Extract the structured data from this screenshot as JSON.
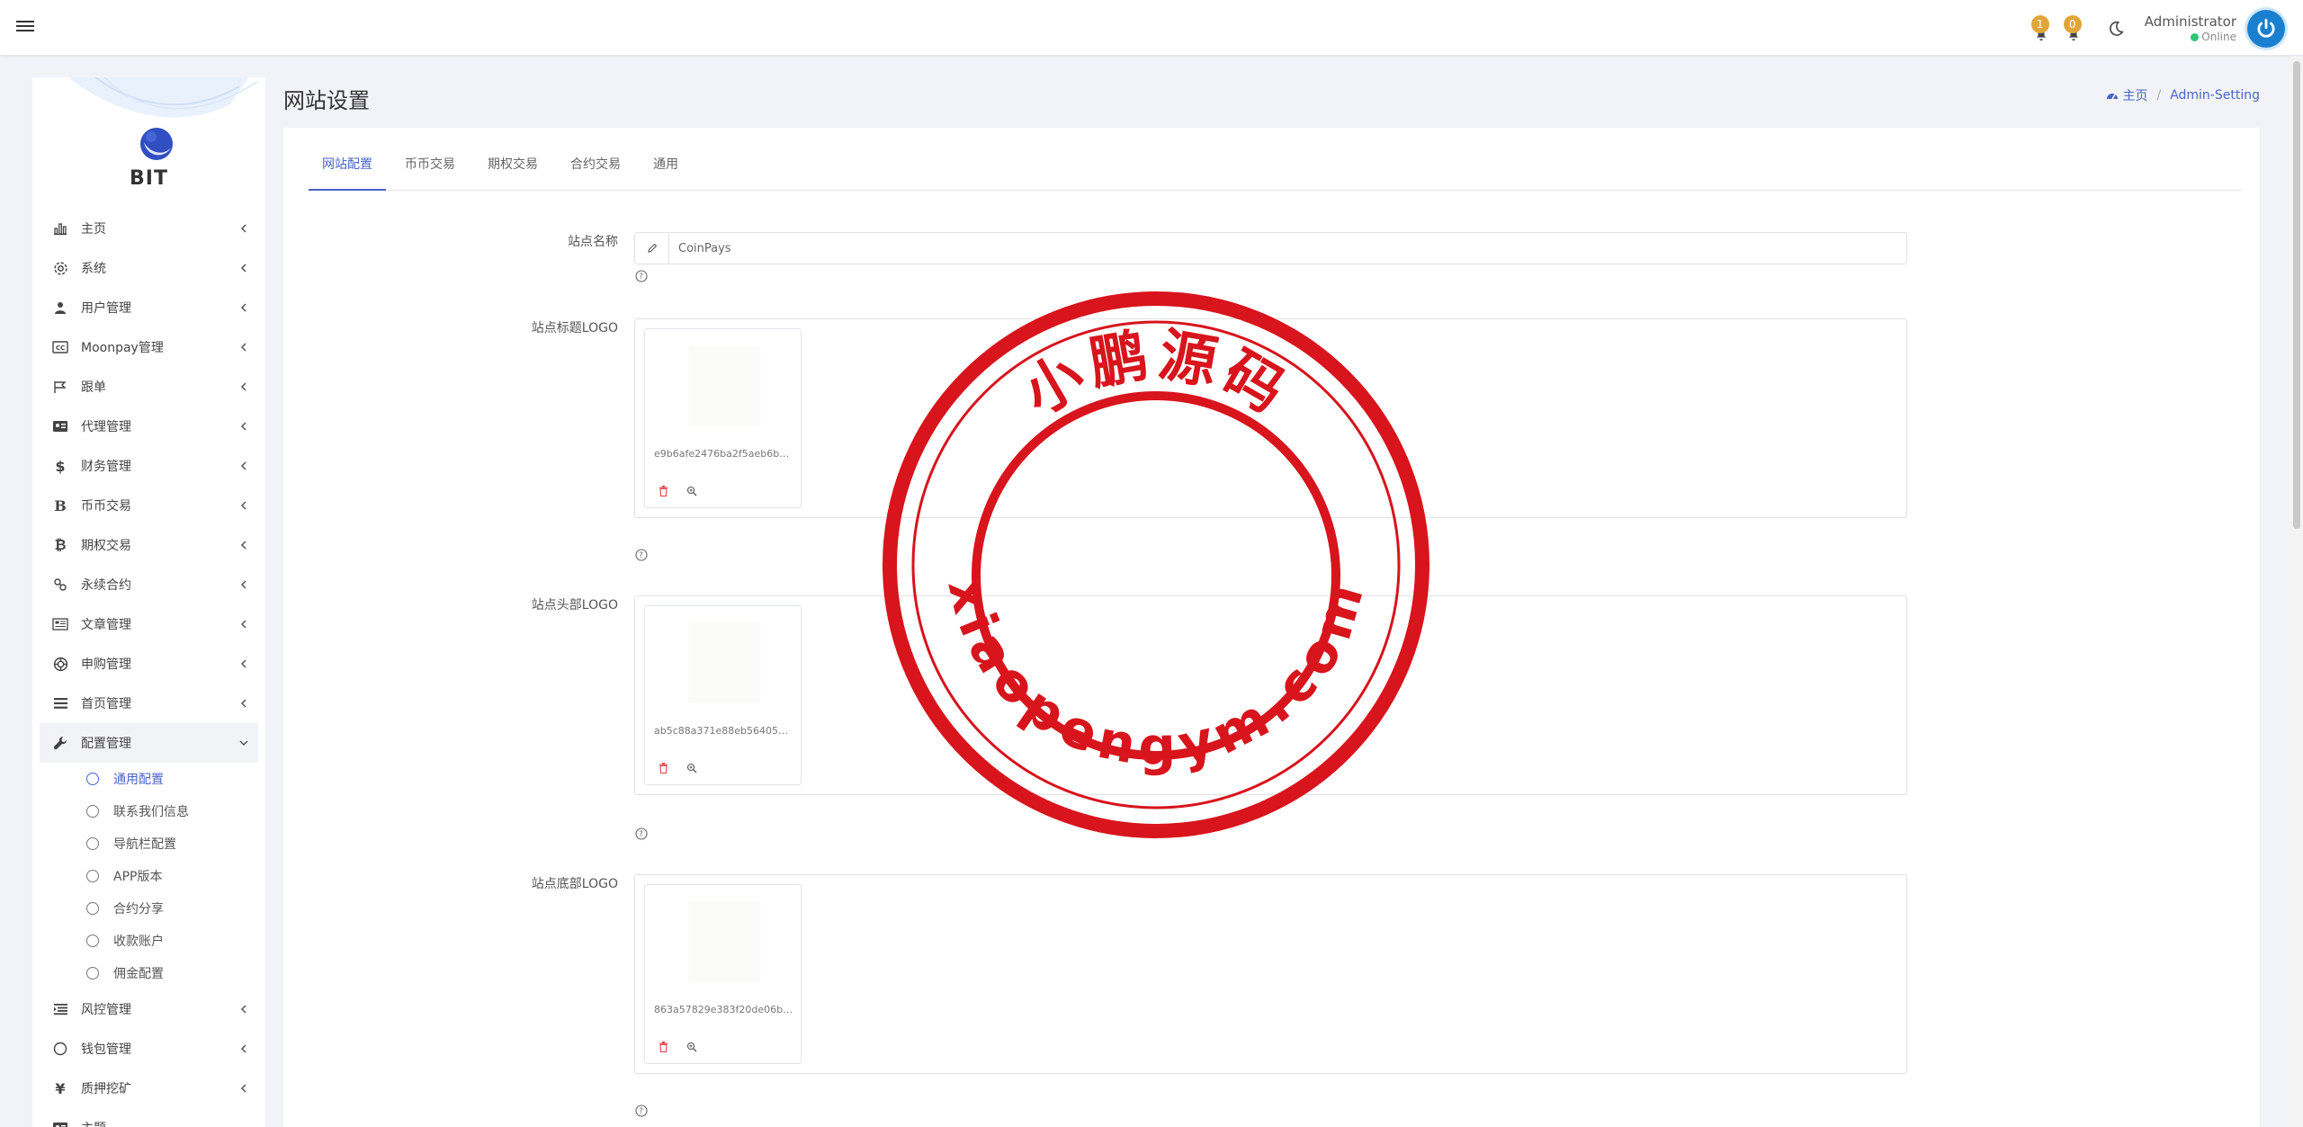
{
  "header": {
    "notifications": [
      {
        "count": "1",
        "icon": "bell-icon"
      },
      {
        "count": "0",
        "icon": "bell-icon"
      }
    ],
    "user_name": "Administrator",
    "user_status": "Online"
  },
  "sidebar": {
    "brand": "BIT",
    "items": [
      {
        "label": "主页",
        "icon": "chart-icon"
      },
      {
        "label": "系统",
        "icon": "gear-icon"
      },
      {
        "label": "用户管理",
        "icon": "user-icon"
      },
      {
        "label": "Moonpay管理",
        "icon": "cc-icon"
      },
      {
        "label": "跟单",
        "icon": "flag-icon"
      },
      {
        "label": "代理管理",
        "icon": "id-card-icon"
      },
      {
        "label": "财务管理",
        "icon": "dollar-icon",
        "glyph": "$"
      },
      {
        "label": "币币交易",
        "icon": "bitcoin-b-icon",
        "glyph": "B"
      },
      {
        "label": "期权交易",
        "icon": "bitcoin-icon",
        "glyph": "₿"
      },
      {
        "label": "永续合约",
        "icon": "link-icon"
      },
      {
        "label": "文章管理",
        "icon": "newspaper-icon"
      },
      {
        "label": "申购管理",
        "icon": "lifebuoy-icon"
      },
      {
        "label": "首页管理",
        "icon": "list-icon"
      },
      {
        "label": "配置管理",
        "icon": "wrench-icon"
      }
    ],
    "config_sub": [
      {
        "label": "通用配置",
        "active": true
      },
      {
        "label": "联系我们信息"
      },
      {
        "label": "导航栏配置"
      },
      {
        "label": "APP版本"
      },
      {
        "label": "合约分享"
      },
      {
        "label": "收款账户"
      },
      {
        "label": "佣金配置"
      }
    ],
    "items_after": [
      {
        "label": "风控管理",
        "icon": "indent-icon"
      },
      {
        "label": "钱包管理",
        "icon": "circle-icon"
      },
      {
        "label": "质押挖矿",
        "icon": "yen-icon",
        "glyph": "¥"
      },
      {
        "label": "主题",
        "icon": "id-card-icon"
      }
    ]
  },
  "page": {
    "title": "网站设置",
    "breadcrumb": {
      "home": "主页",
      "current": "Admin-Setting"
    }
  },
  "tabs": [
    "网站配置",
    "币币交易",
    "期权交易",
    "合约交易",
    "通用"
  ],
  "form": {
    "site_name_label": "站点名称",
    "site_name_value": "CoinPays",
    "title_logo_label": "站点标题LOGO",
    "title_logo_file": "e9b6afe2476ba2f5aeb6b69...",
    "header_logo_label": "站点头部LOGO",
    "header_logo_file": "ab5c88a371e88eb5640567...",
    "footer_logo_label": "站点底部LOGO",
    "footer_logo_file": "863a57829e383f20de06bf5..."
  },
  "watermark": {
    "top": "小鹏源码",
    "bottom": "xiaopengym.com",
    "color": "#d8141c"
  },
  "colors": {
    "accent": "#4a63c8",
    "badge": "#e0a53a",
    "online": "#2ec774"
  }
}
